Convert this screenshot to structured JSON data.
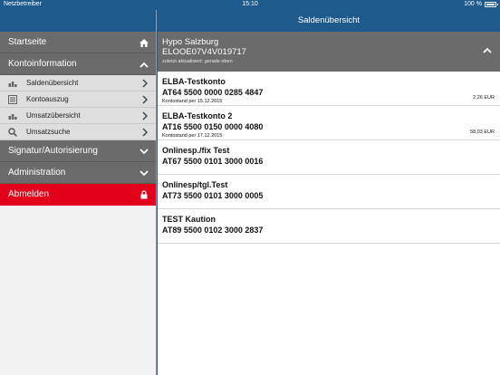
{
  "status_bar": {
    "carrier": "Netzbetreiber",
    "time": "15:10",
    "battery": "100 %"
  },
  "main": {
    "title": "Saldenübersicht"
  },
  "sidebar": {
    "home": {
      "label": "Startseite",
      "icon": "home-icon"
    },
    "kontoinformation": {
      "label": "Kontoinformation",
      "expanded": true,
      "items": [
        {
          "label": "Saldenübersicht",
          "icon": "bar-chart-icon"
        },
        {
          "label": "Kontoauszug",
          "icon": "document-icon"
        },
        {
          "label": "Umsatzübersicht",
          "icon": "bar-chart-icon"
        },
        {
          "label": "Umsatzsuche",
          "icon": "search-icon"
        }
      ]
    },
    "signatur": {
      "label": "Signatur/Autorisierung"
    },
    "administration": {
      "label": "Administration"
    },
    "logout": {
      "label": "Abmelden",
      "icon": "lock-icon",
      "color": "#e2001a"
    }
  },
  "bank": {
    "name": "Hypo Salzburg",
    "code": "ELOOE07V4V019717",
    "updated": "zuletzt aktualisiert: gerade eben"
  },
  "accounts": [
    {
      "name": "ELBA-Testkonto",
      "iban": "AT64 5500 0000 0285 4847",
      "balance_label": "Kontostand per 15.12.2015",
      "balance": "2,26 EUR"
    },
    {
      "name": "ELBA-Testkonto 2",
      "iban": "AT16 5500 0150 0000 4080",
      "balance_label": "Kontostand per 17.12.2015",
      "balance": "58,03 EUR"
    },
    {
      "name": "Onlinesp./fix Test",
      "iban": "AT67 5500 0101 3000 0016"
    },
    {
      "name": "Onlinesp/tgl.Test",
      "iban": "AT73 5500 0101 3000 0005"
    },
    {
      "name": "TEST Kaution",
      "iban": "AT89 5500 0102 3000 2837"
    }
  ],
  "colors": {
    "brand_blue": "#1e5a8c",
    "header_gray": "#6b6b6b",
    "logout_red": "#e2001a"
  }
}
